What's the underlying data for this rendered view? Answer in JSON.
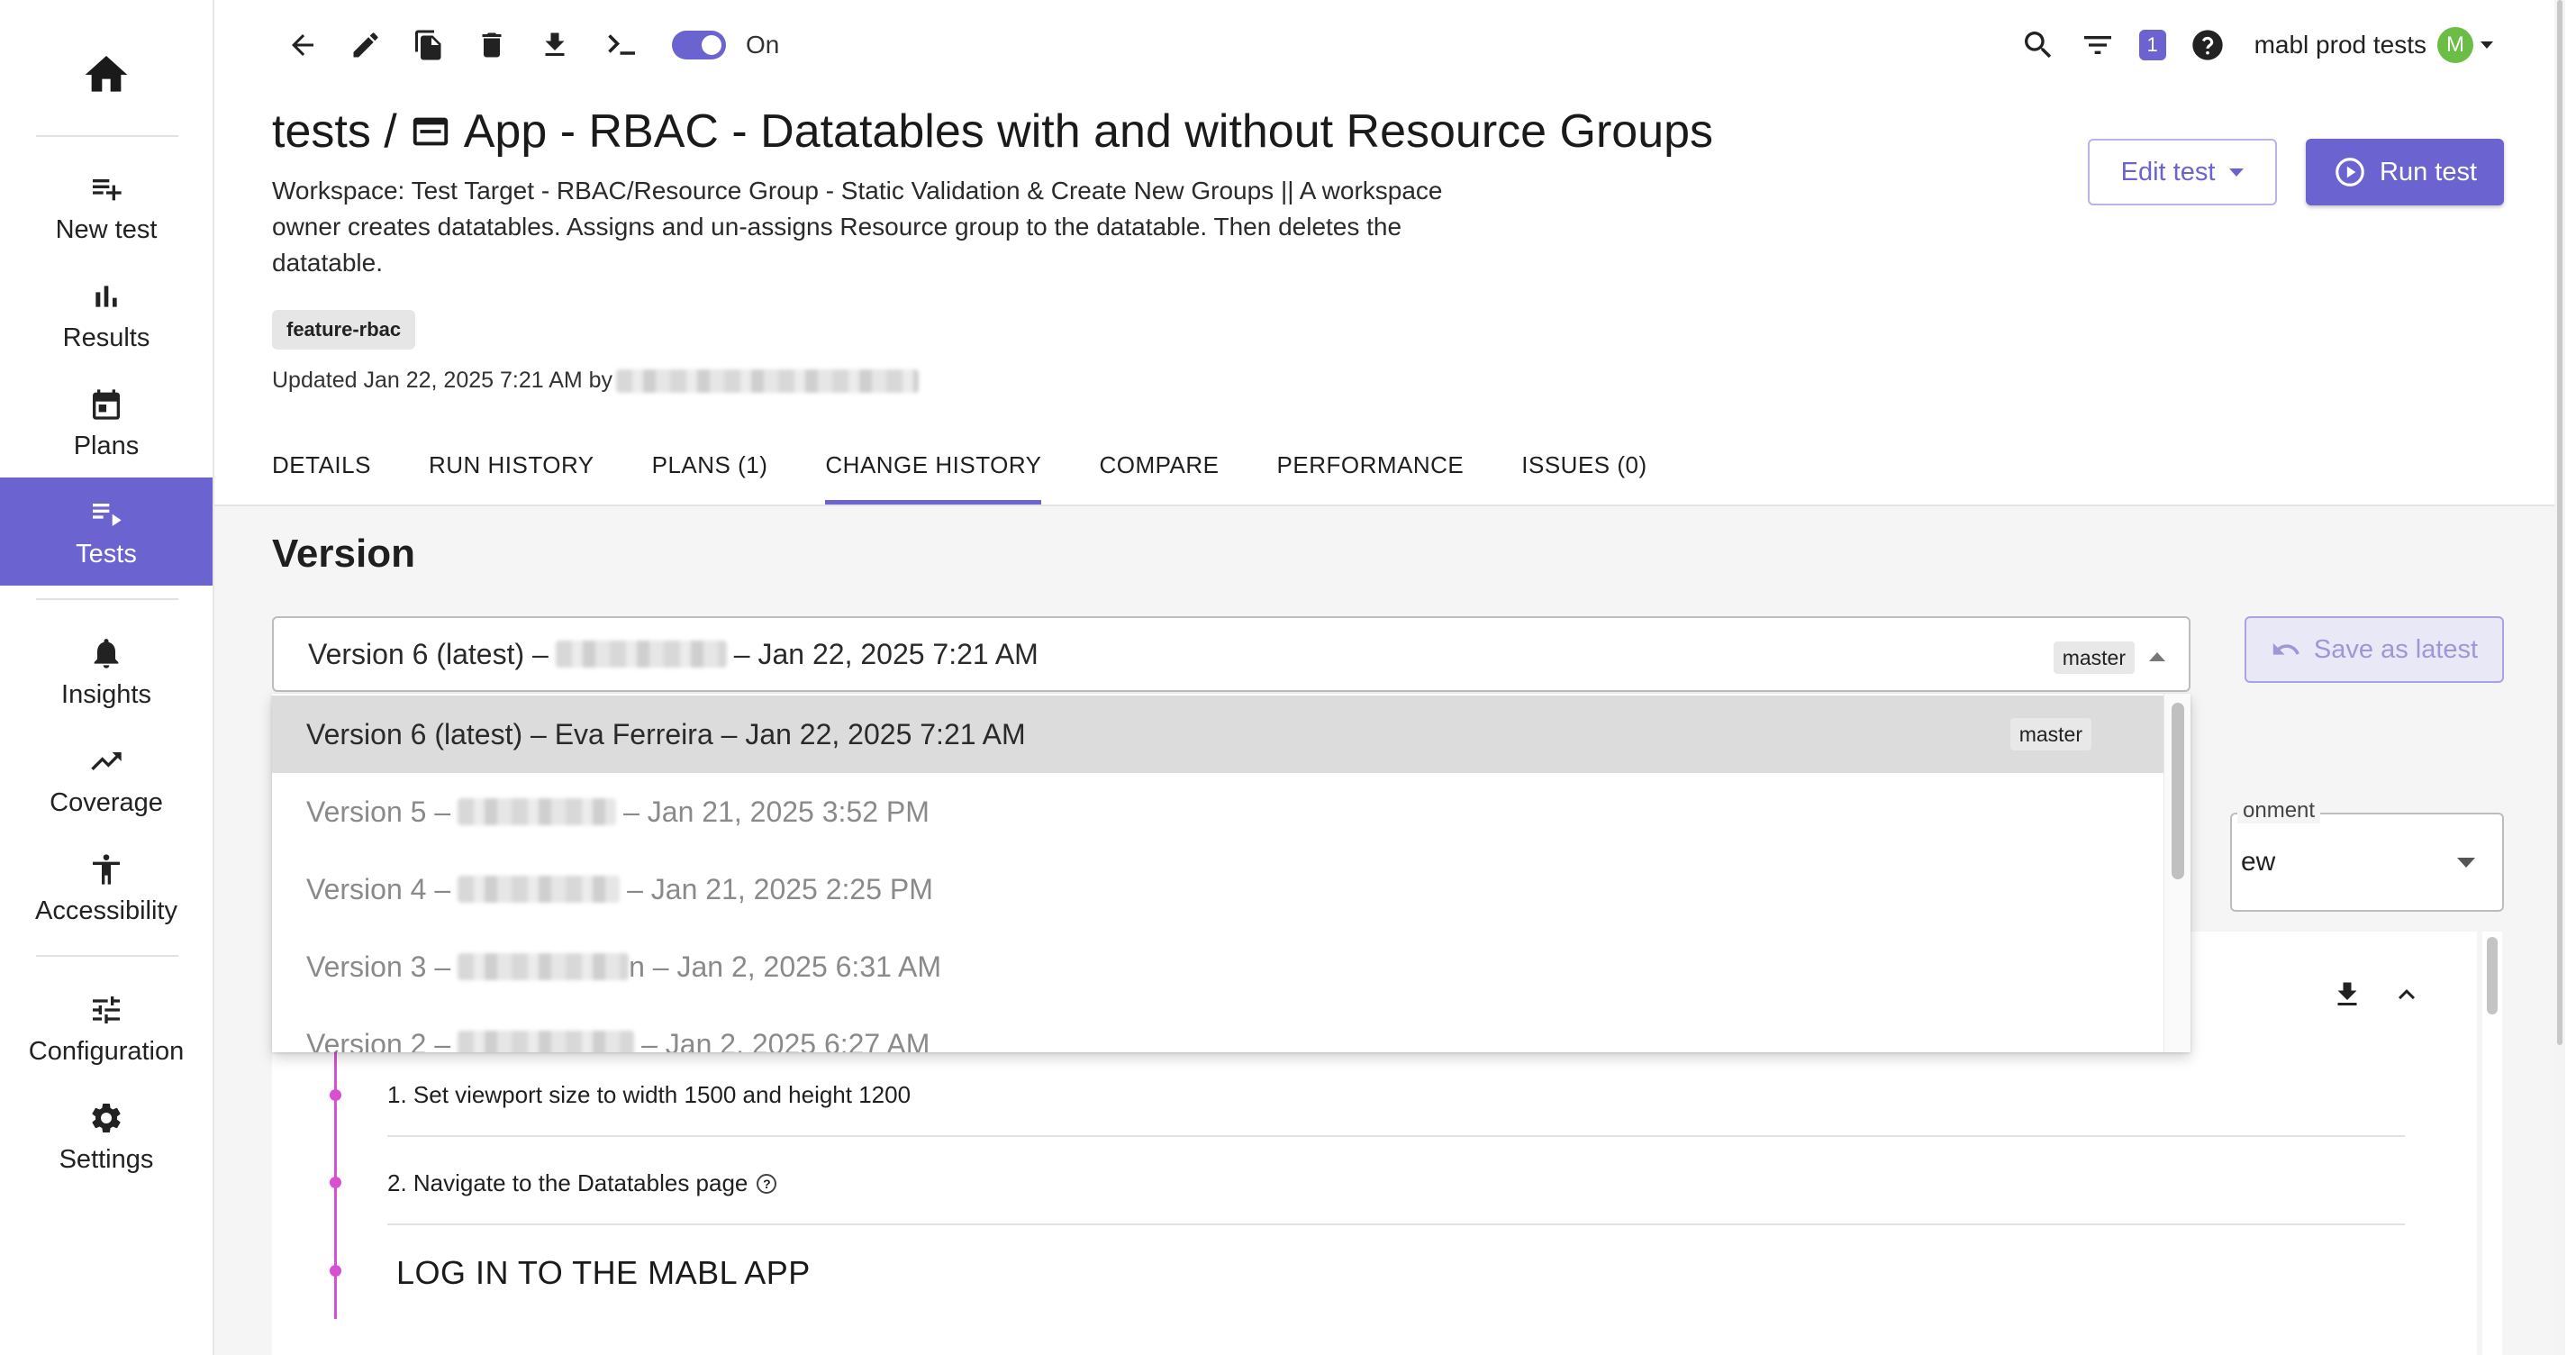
{
  "sidebar": {
    "items": [
      {
        "id": "new-test",
        "label": "New test",
        "icon": "playlist-add-icon"
      },
      {
        "id": "results",
        "label": "Results",
        "icon": "bar-chart-icon"
      },
      {
        "id": "plans",
        "label": "Plans",
        "icon": "calendar-icon"
      },
      {
        "id": "tests",
        "label": "Tests",
        "icon": "playlist-play-icon",
        "active": true
      },
      {
        "id": "insights",
        "label": "Insights",
        "icon": "bell-icon"
      },
      {
        "id": "coverage",
        "label": "Coverage",
        "icon": "trending-up-icon"
      },
      {
        "id": "accessibility",
        "label": "Accessibility",
        "icon": "accessibility-icon"
      },
      {
        "id": "configuration",
        "label": "Configuration",
        "icon": "tune-icon"
      },
      {
        "id": "settings",
        "label": "Settings",
        "icon": "gear-icon"
      }
    ]
  },
  "toolbar": {
    "toggle_label": "On"
  },
  "header": {
    "notification_count": "1",
    "org_name": "mabl prod tests",
    "avatar_initial": "M"
  },
  "test": {
    "breadcrumb": "tests /",
    "name": "App - RBAC - Datatables with and without Resource Groups",
    "description": "Workspace: Test Target - RBAC/Resource Group - Static Validation & Create New Groups || A workspace owner creates datatables. Assigns and un-assigns Resource group to the datatable. Then deletes the datatable.",
    "tag": "feature-rbac",
    "updated": "Updated Jan 22, 2025 7:21 AM by"
  },
  "buttons": {
    "edit": "Edit test",
    "run": "Run test",
    "save_latest": "Save as latest"
  },
  "tabs": [
    {
      "label": "DETAILS"
    },
    {
      "label": "RUN HISTORY"
    },
    {
      "label": "PLANS (1)"
    },
    {
      "label": "CHANGE HISTORY",
      "active": true
    },
    {
      "label": "COMPARE"
    },
    {
      "label": "PERFORMANCE"
    },
    {
      "label": "ISSUES (0)"
    }
  ],
  "version": {
    "section_title": "Version",
    "selected_prefix": "Version 6 (latest) –",
    "selected_suffix": "– Jan 22, 2025 7:21 AM",
    "selected_branch": "master",
    "options": [
      {
        "label": "Version 6 (latest) – Eva Ferreira – Jan 22, 2025 7:21 AM",
        "branch": "master",
        "selected": true
      },
      {
        "prefix": "Version 5 –",
        "suffix": "– Jan 21, 2025 3:52 PM"
      },
      {
        "prefix": "Version 4 –",
        "suffix": "– Jan 21, 2025 2:25 PM"
      },
      {
        "prefix": "Version 3 –",
        "suffix": "n – Jan 2, 2025 6:31 AM"
      },
      {
        "prefix": "Version 2 –",
        "suffix": "– Jan 2, 2025 6:27 AM"
      }
    ]
  },
  "environment": {
    "label": "onment",
    "value": "ew"
  },
  "steps": [
    {
      "text": "1. Set viewport size to width 1500 and height 1200"
    },
    {
      "text": "2. Navigate to the Datatables page"
    }
  ],
  "step_heading": "LOG IN TO THE MABL APP",
  "colors": {
    "accent": "#6b63d0",
    "timeline": "#d84fd3",
    "avatar": "#6bbd45"
  }
}
